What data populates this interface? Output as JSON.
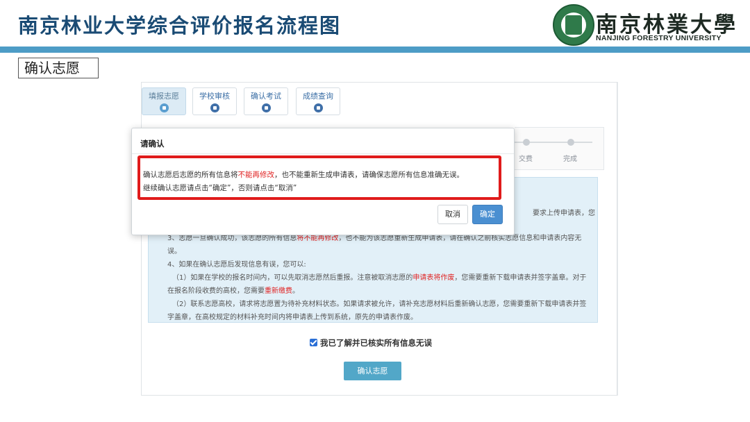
{
  "slide": {
    "title": "南京林业大学综合评价报名流程图",
    "section_label": "确认志愿"
  },
  "logo": {
    "cn": "南京林業大學",
    "en": "NANJING FORESTRY UNIVERSITY",
    "colors": {
      "seal": "#2f7a4a",
      "bar": "#4d9cc6"
    }
  },
  "steps": [
    {
      "label": "填报志愿",
      "icon": "circle-dot-icon",
      "active": true
    },
    {
      "label": "学校审核",
      "icon": "document-icon",
      "active": false
    },
    {
      "label": "确认考试",
      "icon": "document-icon",
      "active": false
    },
    {
      "label": "成绩查询",
      "icon": "document-icon",
      "active": false
    }
  ],
  "progress": {
    "labels": [
      "交费",
      "完成"
    ]
  },
  "info_lines": {
    "l1_tail": "要求上传申请表，您需",
    "l3": [
      "3、志愿一旦确认成功，该志愿的所有信息",
      "将不能再修改",
      "，也不能为该志愿重新生成申请表，请在确认之前核实志愿信息和申请表内容无"
    ],
    "l3b": "误。",
    "l4": "4、如果在确认志愿后发现信息有误，您可以:",
    "l5": [
      "（1）如果在学校的报名时间内，可以先取消志愿然后重报。注意被取消志愿的",
      "申请表将作废",
      "，您需要重新下载申请表并签字盖章。对于"
    ],
    "l5b": [
      "在报名阶段收费的高校，您需要",
      "重新缴费",
      "。"
    ],
    "l6": "（2）联系志愿高校，请求将志愿置为待补充材料状态。如果请求被允许，请补充志愿材料后重新确认志愿，您需要重新下载申请表并签",
    "l6b": "字盖章，在高校规定的材料补充时间内将申请表上传到系统，原先的申请表作废。"
  },
  "agree": {
    "label": "我已了解并已核实所有信息无误",
    "checked": true
  },
  "confirm_button": "确认志愿",
  "modal": {
    "title": "请确认",
    "msg1_a": "确认志愿后志愿的所有信息将",
    "msg1_red": "不能再修改",
    "msg1_b": "，也不能重新生成申请表，请确保志愿所有信息准确无误。",
    "msg2": "继续确认志愿请点击“确定”，否则请点击“取消”",
    "cancel": "取消",
    "ok": "确定",
    "highlight_color": "#e01b1b"
  }
}
